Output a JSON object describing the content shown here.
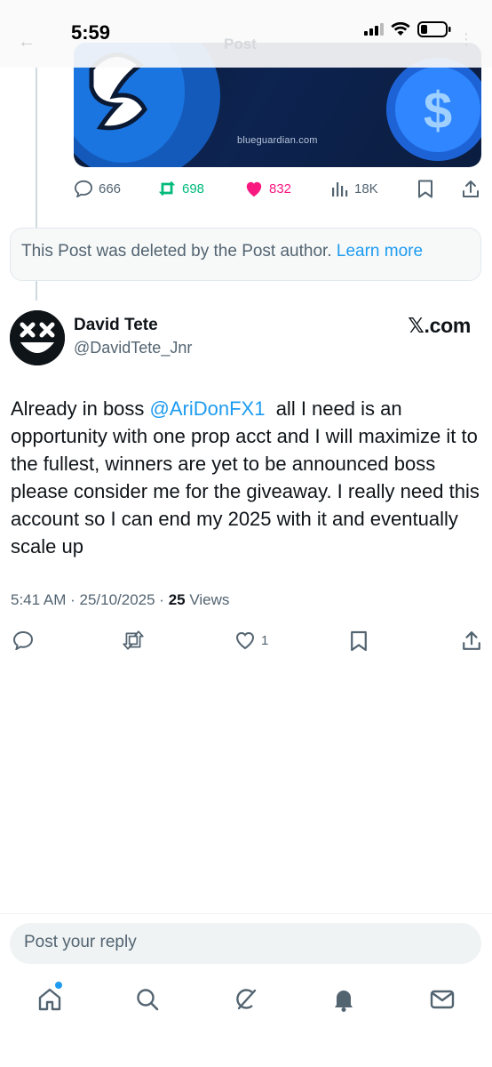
{
  "status_bar": {
    "time": "5:59"
  },
  "header": {
    "title": "Post"
  },
  "ad": {
    "url": "blueguardian.com"
  },
  "prev_post": {
    "replies": "666",
    "reposts": "698",
    "likes": "832",
    "views": "18K"
  },
  "deleted_notice": {
    "text": "This Post was deleted by the Post author.",
    "link": "Learn more"
  },
  "post": {
    "author_name": "David Tete",
    "author_handle": "@DavidTete_Jnr",
    "watermark": "𝕏.com",
    "text_before": "Already in boss ",
    "mention": "@AriDonFX1",
    "text_after": "  all I need is an opportunity with one prop acct and I will maximize it to the fullest, winners are yet to be announced boss please consider me for the giveaway. I really need this account so I can end my 2025 with it and eventually scale up",
    "time": "5:41 AM",
    "date": "25/10/2025",
    "views_count": "25",
    "views_label": "Views",
    "likes": "1"
  },
  "reply_box": {
    "placeholder": "Post your reply"
  },
  "tabbar": {
    "items": [
      "home",
      "search",
      "grok",
      "notifications",
      "messages"
    ]
  },
  "colors": {
    "accent": "#1d9bf0",
    "repost_green": "#00ba7c",
    "like_pink": "#f91880",
    "muted": "#536471"
  }
}
